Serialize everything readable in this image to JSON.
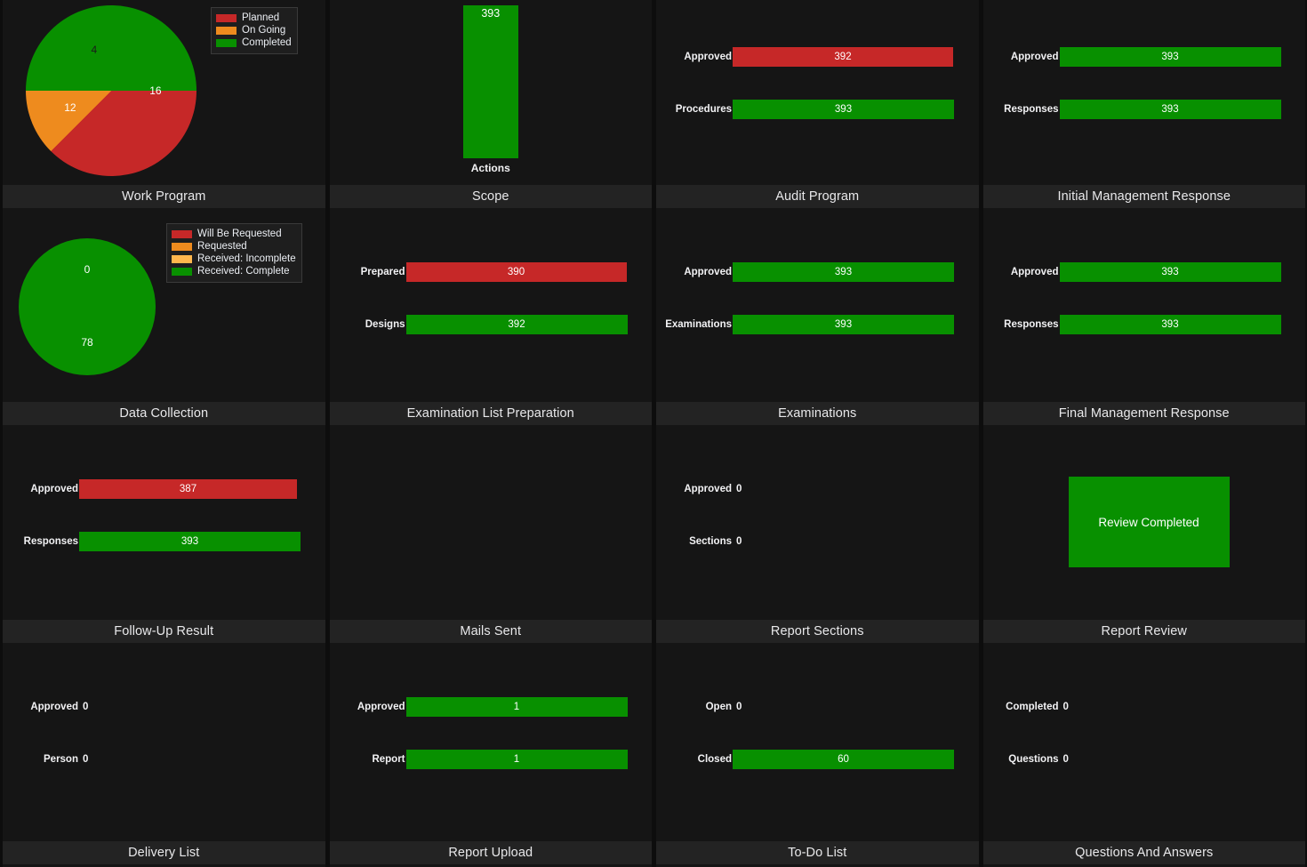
{
  "colors": {
    "page_background": "#0d0d0d",
    "panel_background": "#151515",
    "panel_title_background": "#232323",
    "red": "#c62828",
    "orange": "#ee8b1e",
    "light_orange": "#ffb74d",
    "green": "#089000",
    "text": "#f2f2f4"
  },
  "panels": [
    {
      "id": "work-program",
      "title": "Work Program",
      "type": "pie",
      "legend": [
        {
          "label": "Planned",
          "color": "#c62828"
        },
        {
          "label": "On Going",
          "color": "#ee8b1e"
        },
        {
          "label": "Completed",
          "color": "#089000"
        }
      ],
      "chart_data": {
        "type": "pie",
        "title": "Work Program",
        "categories": [
          "Completed",
          "Planned",
          "On Going"
        ],
        "values": [
          16,
          12,
          4
        ],
        "colors": [
          "#089000",
          "#c62828",
          "#ee8b1e"
        ],
        "total": 32,
        "legend": [
          "Planned",
          "On Going",
          "Completed"
        ],
        "legend_position": "top-right"
      }
    },
    {
      "id": "scope",
      "title": "Scope",
      "type": "vbar",
      "chart_data": {
        "type": "bar",
        "title": "Scope",
        "orientation": "vertical",
        "categories": [
          "Actions"
        ],
        "values": [
          393
        ],
        "colors": [
          "#089000"
        ],
        "xlabel": "",
        "ylabel": ""
      }
    },
    {
      "id": "audit-program",
      "title": "Audit Program",
      "type": "hbar",
      "chart_data": {
        "type": "bar",
        "title": "Audit Program",
        "orientation": "horizontal",
        "categories": [
          "Approved",
          "Procedures"
        ],
        "values": [
          392,
          393
        ],
        "colors": [
          "#c62828",
          "#089000"
        ],
        "max": 393
      }
    },
    {
      "id": "initial-management-response",
      "title": "Initial Management Response",
      "type": "hbar",
      "chart_data": {
        "type": "bar",
        "title": "Initial Management Response",
        "orientation": "horizontal",
        "categories": [
          "Approved",
          "Responses"
        ],
        "values": [
          393,
          393
        ],
        "colors": [
          "#089000",
          "#089000"
        ],
        "max": 393
      }
    },
    {
      "id": "data-collection",
      "title": "Data Collection",
      "type": "pie",
      "legend": [
        {
          "label": "Will Be Requested",
          "color": "#c62828"
        },
        {
          "label": "Requested",
          "color": "#ee8b1e"
        },
        {
          "label": "Received: Incomplete",
          "color": "#ffb74d"
        },
        {
          "label": "Received: Complete",
          "color": "#089000"
        }
      ],
      "chart_data": {
        "type": "pie",
        "title": "Data Collection",
        "categories": [
          "Received: Complete",
          "Will Be Requested"
        ],
        "values": [
          78,
          0
        ],
        "colors": [
          "#089000",
          "#c62828"
        ],
        "total": 78,
        "legend": [
          "Will Be Requested",
          "Requested",
          "Received: Incomplete",
          "Received: Complete"
        ],
        "legend_position": "top-right"
      }
    },
    {
      "id": "examination-list-preparation",
      "title": "Examination List Preparation",
      "type": "hbar",
      "chart_data": {
        "type": "bar",
        "title": "Examination List Preparation",
        "orientation": "horizontal",
        "categories": [
          "Prepared",
          "Designs"
        ],
        "values": [
          390,
          392
        ],
        "colors": [
          "#c62828",
          "#089000"
        ],
        "max": 392
      }
    },
    {
      "id": "examinations",
      "title": "Examinations",
      "type": "hbar",
      "chart_data": {
        "type": "bar",
        "title": "Examinations",
        "orientation": "horizontal",
        "categories": [
          "Approved",
          "Examinations"
        ],
        "values": [
          393,
          393
        ],
        "colors": [
          "#089000",
          "#089000"
        ],
        "max": 393
      }
    },
    {
      "id": "final-management-response",
      "title": "Final Management Response",
      "type": "hbar",
      "chart_data": {
        "type": "bar",
        "title": "Final Management Response",
        "orientation": "horizontal",
        "categories": [
          "Approved",
          "Responses"
        ],
        "values": [
          393,
          393
        ],
        "colors": [
          "#089000",
          "#089000"
        ],
        "max": 393
      }
    },
    {
      "id": "follow-up-result",
      "title": "Follow-Up Result",
      "type": "hbar",
      "chart_data": {
        "type": "bar",
        "title": "Follow-Up Result",
        "orientation": "horizontal",
        "categories": [
          "Approved",
          "Responses"
        ],
        "values": [
          387,
          393
        ],
        "colors": [
          "#c62828",
          "#089000"
        ],
        "max": 393
      }
    },
    {
      "id": "mails-sent",
      "title": "Mails Sent",
      "type": "empty",
      "chart_data": {
        "type": "bar",
        "title": "Mails Sent",
        "orientation": "horizontal",
        "categories": [],
        "values": []
      }
    },
    {
      "id": "report-sections",
      "title": "Report Sections",
      "type": "hbar",
      "chart_data": {
        "type": "bar",
        "title": "Report Sections",
        "orientation": "horizontal",
        "categories": [
          "Approved",
          "Sections"
        ],
        "values": [
          0,
          0
        ],
        "colors": [
          "#089000",
          "#089000"
        ],
        "max": 0
      }
    },
    {
      "id": "report-review",
      "title": "Report Review",
      "type": "status",
      "status": {
        "label": "Review Completed",
        "color": "#089000"
      },
      "chart_data": {
        "type": "table",
        "title": "Report Review",
        "categories": [
          "Review Completed"
        ],
        "values": [
          1
        ]
      }
    },
    {
      "id": "delivery-list",
      "title": "Delivery List",
      "type": "hbar",
      "chart_data": {
        "type": "bar",
        "title": "Delivery List",
        "orientation": "horizontal",
        "categories": [
          "Approved",
          "Person"
        ],
        "values": [
          0,
          0
        ],
        "colors": [
          "#089000",
          "#089000"
        ],
        "max": 0
      }
    },
    {
      "id": "report-upload",
      "title": "Report Upload",
      "type": "hbar",
      "chart_data": {
        "type": "bar",
        "title": "Report Upload",
        "orientation": "horizontal",
        "categories": [
          "Approved",
          "Report"
        ],
        "values": [
          1,
          1
        ],
        "colors": [
          "#089000",
          "#089000"
        ],
        "max": 1
      }
    },
    {
      "id": "to-do-list",
      "title": "To-Do List",
      "type": "hbar",
      "chart_data": {
        "type": "bar",
        "title": "To-Do List",
        "orientation": "horizontal",
        "categories": [
          "Open",
          "Closed"
        ],
        "values": [
          0,
          60
        ],
        "colors": [
          "#089000",
          "#089000"
        ],
        "max": 60
      }
    },
    {
      "id": "questions-and-answers",
      "title": "Questions And Answers",
      "type": "hbar",
      "chart_data": {
        "type": "bar",
        "title": "Questions And Answers",
        "orientation": "horizontal",
        "categories": [
          "Completed",
          "Questions"
        ],
        "values": [
          0,
          0
        ],
        "colors": [
          "#089000",
          "#089000"
        ],
        "max": 0
      }
    }
  ]
}
